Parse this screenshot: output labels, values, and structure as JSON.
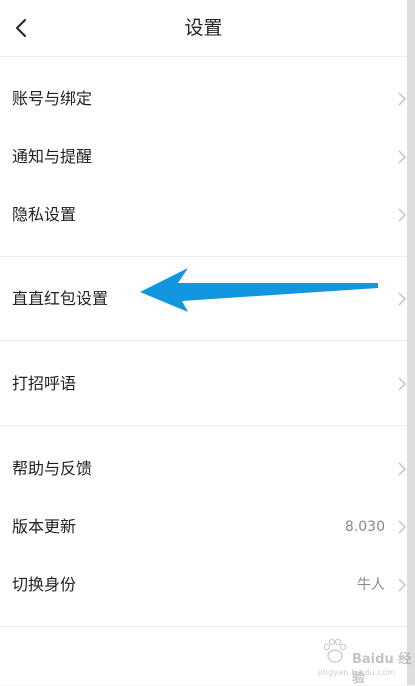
{
  "header": {
    "title": "设置",
    "back_icon": "chevron-left-icon"
  },
  "groups": [
    {
      "items": [
        {
          "label": "账号与绑定"
        },
        {
          "label": "通知与提醒"
        },
        {
          "label": "隐私设置"
        }
      ]
    },
    {
      "items": [
        {
          "label": "直直红包设置",
          "highlighted": true
        }
      ]
    },
    {
      "items": [
        {
          "label": "打招呼语"
        }
      ]
    },
    {
      "items": [
        {
          "label": "帮助与反馈"
        },
        {
          "label": "版本更新",
          "value": "8.030"
        },
        {
          "label": "切换身份",
          "value": "牛人"
        }
      ]
    }
  ],
  "annotation": {
    "icon": "arrow-left-icon",
    "color": "#1296e0"
  },
  "watermark": {
    "brand": "Baidu 经验",
    "site": "jingyan.baidu.com"
  },
  "colors": {
    "background": "#ffffff",
    "divider": "#ececec",
    "chevron": "#c4c4c4",
    "value_text": "#8a8a8a"
  }
}
